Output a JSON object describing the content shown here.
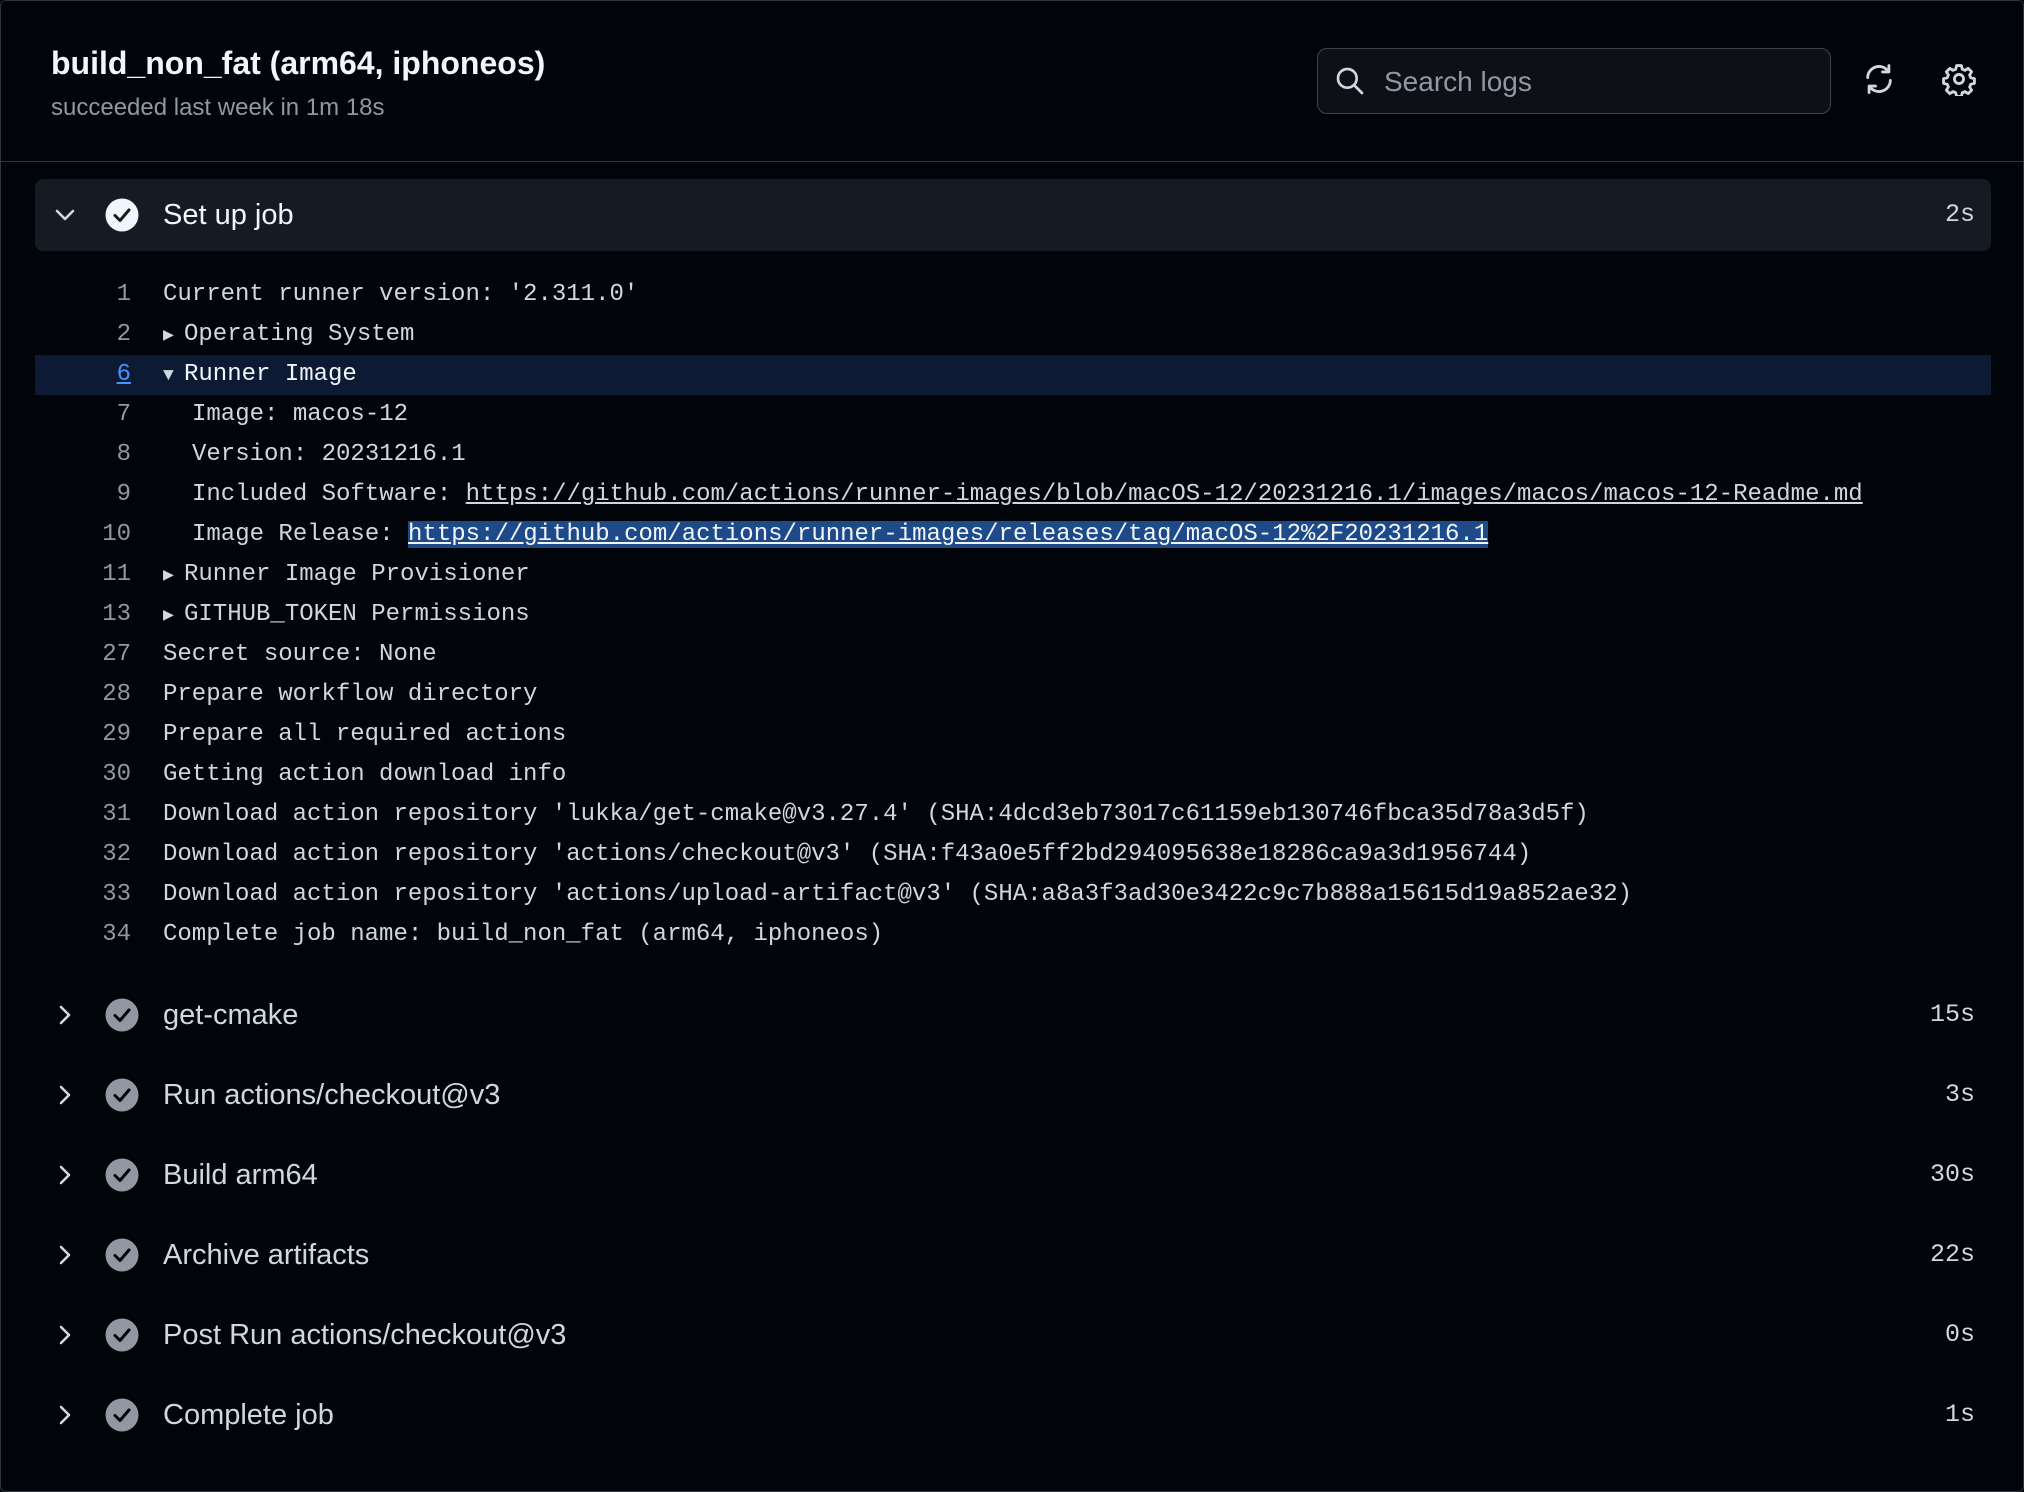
{
  "header": {
    "title": "build_non_fat (arm64, iphoneos)",
    "subtitle": "succeeded last week in 1m 18s",
    "search_placeholder": "Search logs"
  },
  "expanded_step": {
    "name": "Set up job",
    "duration": "2s",
    "lines": [
      {
        "num": "1",
        "text": "Current runner version: '2.311.0'"
      },
      {
        "num": "2",
        "text": "Operating System",
        "toggle": "collapsed"
      },
      {
        "num": "6",
        "text": "Runner Image",
        "toggle": "expanded",
        "selected": true
      },
      {
        "num": "7",
        "text": "Image: macos-12",
        "indent": true
      },
      {
        "num": "8",
        "text": "Version: 20231216.1",
        "indent": true
      },
      {
        "num": "9",
        "prefix": "Included Software: ",
        "url": "https://github.com/actions/runner-images/blob/macOS-12/20231216.1/images/macos/macos-12-Readme.md",
        "indent": true
      },
      {
        "num": "10",
        "prefix": "Image Release: ",
        "url": "https://github.com/actions/runner-images/releases/tag/macOS-12%2F20231216.1",
        "indent": true,
        "highlight": true
      },
      {
        "num": "11",
        "text": "Runner Image Provisioner",
        "toggle": "collapsed"
      },
      {
        "num": "13",
        "text": "GITHUB_TOKEN Permissions",
        "toggle": "collapsed"
      },
      {
        "num": "27",
        "text": "Secret source: None"
      },
      {
        "num": "28",
        "text": "Prepare workflow directory"
      },
      {
        "num": "29",
        "text": "Prepare all required actions"
      },
      {
        "num": "30",
        "text": "Getting action download info"
      },
      {
        "num": "31",
        "text": "Download action repository 'lukka/get-cmake@v3.27.4' (SHA:4dcd3eb73017c61159eb130746fbca35d78a3d5f)"
      },
      {
        "num": "32",
        "text": "Download action repository 'actions/checkout@v3' (SHA:f43a0e5ff2bd294095638e18286ca9a3d1956744)"
      },
      {
        "num": "33",
        "text": "Download action repository 'actions/upload-artifact@v3' (SHA:a8a3f3ad30e3422c9c7b888a15615d19a852ae32)"
      },
      {
        "num": "34",
        "text": "Complete job name: build_non_fat (arm64, iphoneos)"
      }
    ]
  },
  "steps": [
    {
      "name": "get-cmake",
      "duration": "15s"
    },
    {
      "name": "Run actions/checkout@v3",
      "duration": "3s"
    },
    {
      "name": "Build arm64",
      "duration": "30s"
    },
    {
      "name": "Archive artifacts",
      "duration": "22s"
    },
    {
      "name": "Post Run actions/checkout@v3",
      "duration": "0s"
    },
    {
      "name": "Complete job",
      "duration": "1s"
    }
  ],
  "colors": {
    "background": "#010409",
    "step_success_icon": "#9198a1",
    "link_selected": "#4493f8",
    "selection_highlight": "#1f4a8a"
  },
  "icons": [
    "search-icon",
    "refresh-icon",
    "gear-icon",
    "chevron-down-icon",
    "chevron-right-icon",
    "check-circle-icon"
  ]
}
